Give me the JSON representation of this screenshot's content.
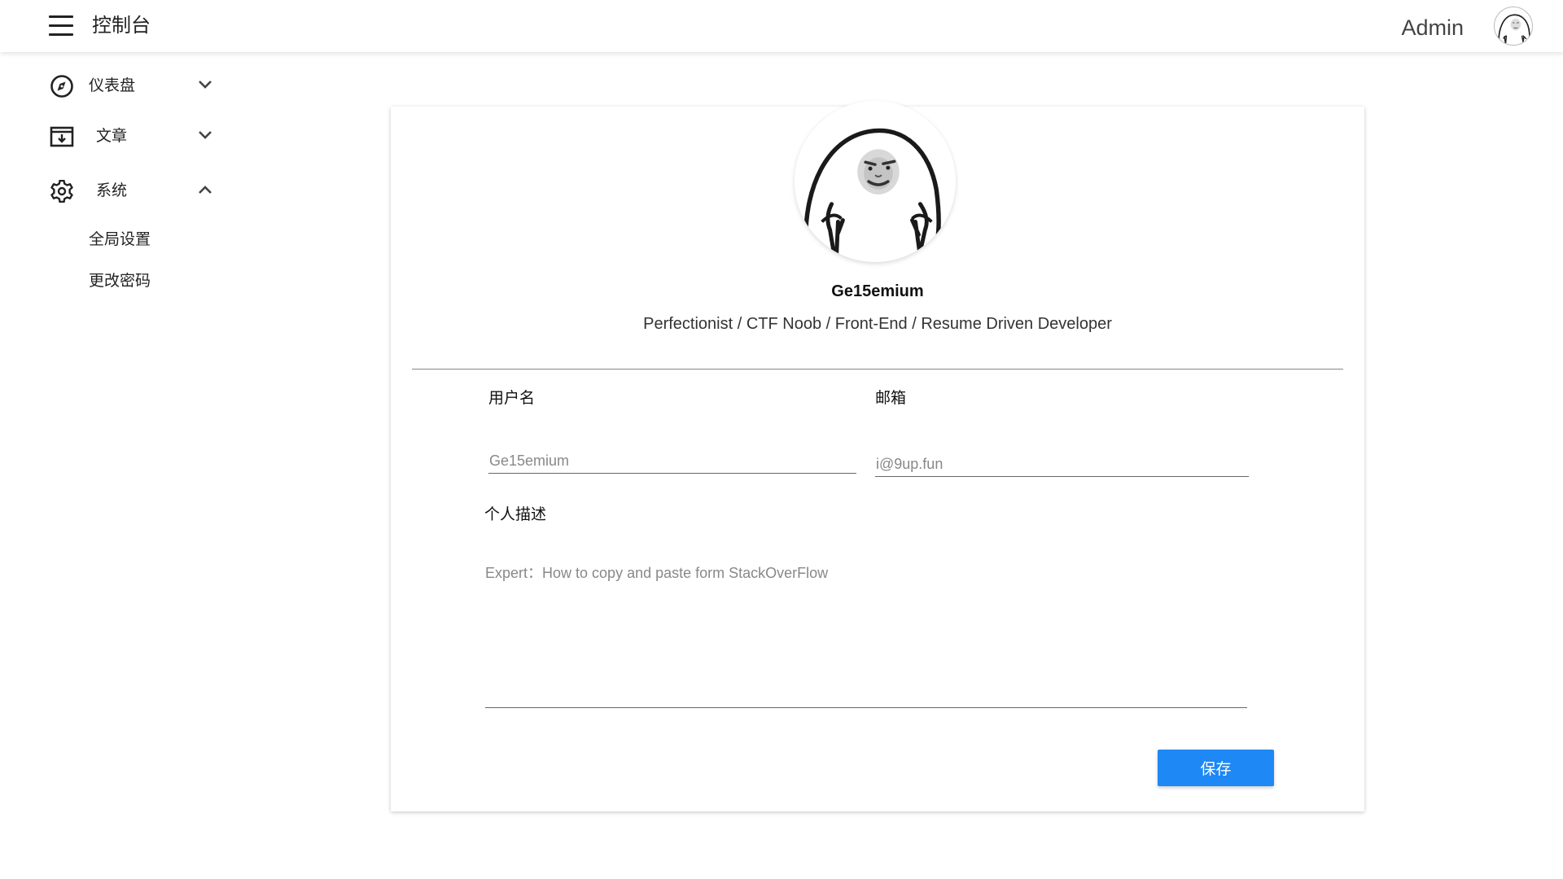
{
  "header": {
    "title": "控制台",
    "user_name": "Admin"
  },
  "sidebar": {
    "items": [
      {
        "label": "仪表盘",
        "icon": "compass-icon",
        "expanded": false
      },
      {
        "label": "文章",
        "icon": "archive-icon",
        "expanded": false
      },
      {
        "label": "系统",
        "icon": "gear-icon",
        "expanded": true,
        "children": [
          {
            "label": "全局设置"
          },
          {
            "label": "更改密码"
          }
        ]
      }
    ]
  },
  "profile": {
    "name": "Ge15emium",
    "bio": "Perfectionist / CTF Noob / Front-End / Resume Driven Developer"
  },
  "form": {
    "username_label": "用户名",
    "username_placeholder": "Ge15emium",
    "email_label": "邮箱",
    "email_placeholder": "i@9up.fun",
    "description_label": "个人描述",
    "description_placeholder": "Expert：How to copy and paste form StackOverFlow",
    "save_label": "保存"
  },
  "colors": {
    "primary": "#1e88f5",
    "text": "#222222"
  }
}
